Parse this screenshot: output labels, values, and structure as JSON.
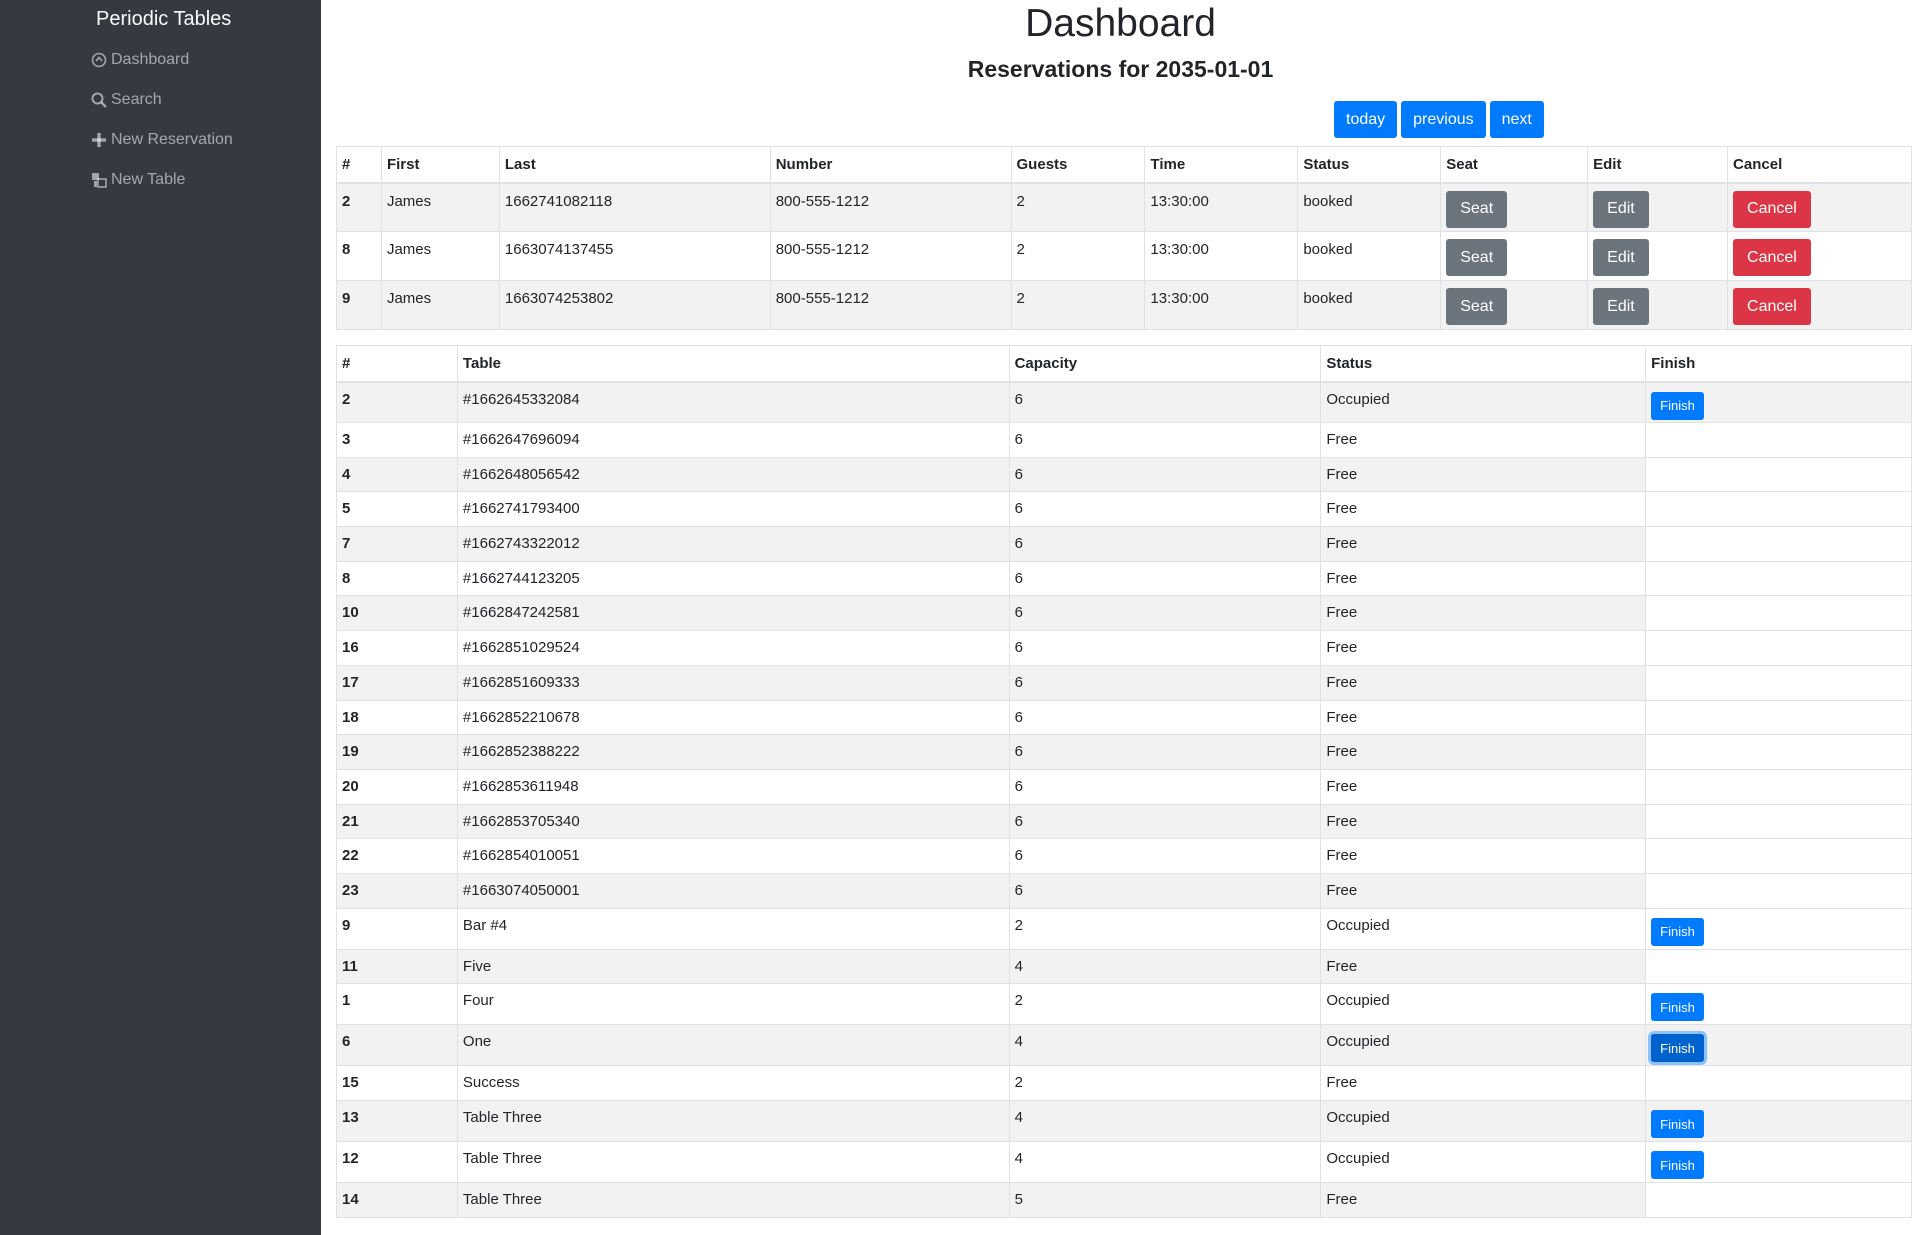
{
  "sidebar": {
    "brand": "Periodic Tables",
    "items": [
      {
        "label": "Dashboard",
        "icon": "dashboard-icon"
      },
      {
        "label": "Search",
        "icon": "search-icon"
      },
      {
        "label": "New Reservation",
        "icon": "plus-icon"
      },
      {
        "label": "New Table",
        "icon": "table-icon"
      }
    ]
  },
  "header": {
    "title": "Dashboard",
    "subtitle": "Reservations for 2035-01-01",
    "today_label": "today",
    "previous_label": "previous",
    "next_label": "next"
  },
  "reservations": {
    "columns": [
      "#",
      "First",
      "Last",
      "Number",
      "Guests",
      "Time",
      "Status",
      "Seat",
      "Edit",
      "Cancel"
    ],
    "seat_label": "Seat",
    "edit_label": "Edit",
    "cancel_label": "Cancel",
    "rows": [
      {
        "id": "2",
        "first": "James",
        "last": "1662741082118",
        "number": "800-555-1212",
        "guests": "2",
        "time": "13:30:00",
        "status": "booked"
      },
      {
        "id": "8",
        "first": "James",
        "last": "1663074137455",
        "number": "800-555-1212",
        "guests": "2",
        "time": "13:30:00",
        "status": "booked"
      },
      {
        "id": "9",
        "first": "James",
        "last": "1663074253802",
        "number": "800-555-1212",
        "guests": "2",
        "time": "13:30:00",
        "status": "booked"
      }
    ]
  },
  "tables": {
    "columns": [
      "#",
      "Table",
      "Capacity",
      "Status",
      "Finish"
    ],
    "finish_label": "Finish",
    "rows": [
      {
        "id": "2",
        "name": "#1662645332084",
        "capacity": "6",
        "status": "Occupied"
      },
      {
        "id": "3",
        "name": "#1662647696094",
        "capacity": "6",
        "status": "Free"
      },
      {
        "id": "4",
        "name": "#1662648056542",
        "capacity": "6",
        "status": "Free"
      },
      {
        "id": "5",
        "name": "#1662741793400",
        "capacity": "6",
        "status": "Free"
      },
      {
        "id": "7",
        "name": "#1662743322012",
        "capacity": "6",
        "status": "Free"
      },
      {
        "id": "8",
        "name": "#1662744123205",
        "capacity": "6",
        "status": "Free"
      },
      {
        "id": "10",
        "name": "#1662847242581",
        "capacity": "6",
        "status": "Free"
      },
      {
        "id": "16",
        "name": "#1662851029524",
        "capacity": "6",
        "status": "Free"
      },
      {
        "id": "17",
        "name": "#1662851609333",
        "capacity": "6",
        "status": "Free"
      },
      {
        "id": "18",
        "name": "#1662852210678",
        "capacity": "6",
        "status": "Free"
      },
      {
        "id": "19",
        "name": "#1662852388222",
        "capacity": "6",
        "status": "Free"
      },
      {
        "id": "20",
        "name": "#1662853611948",
        "capacity": "6",
        "status": "Free"
      },
      {
        "id": "21",
        "name": "#1662853705340",
        "capacity": "6",
        "status": "Free"
      },
      {
        "id": "22",
        "name": "#1662854010051",
        "capacity": "6",
        "status": "Free"
      },
      {
        "id": "23",
        "name": "#1663074050001",
        "capacity": "6",
        "status": "Free"
      },
      {
        "id": "9",
        "name": "Bar #4",
        "capacity": "2",
        "status": "Occupied"
      },
      {
        "id": "11",
        "name": "Five",
        "capacity": "4",
        "status": "Free"
      },
      {
        "id": "1",
        "name": "Four",
        "capacity": "2",
        "status": "Occupied"
      },
      {
        "id": "6",
        "name": "One",
        "capacity": "4",
        "status": "Occupied",
        "focused": true
      },
      {
        "id": "15",
        "name": "Success",
        "capacity": "2",
        "status": "Free"
      },
      {
        "id": "13",
        "name": "Table Three",
        "capacity": "4",
        "status": "Occupied"
      },
      {
        "id": "12",
        "name": "Table Three",
        "capacity": "4",
        "status": "Occupied"
      },
      {
        "id": "14",
        "name": "Table Three",
        "capacity": "5",
        "status": "Free"
      }
    ]
  }
}
